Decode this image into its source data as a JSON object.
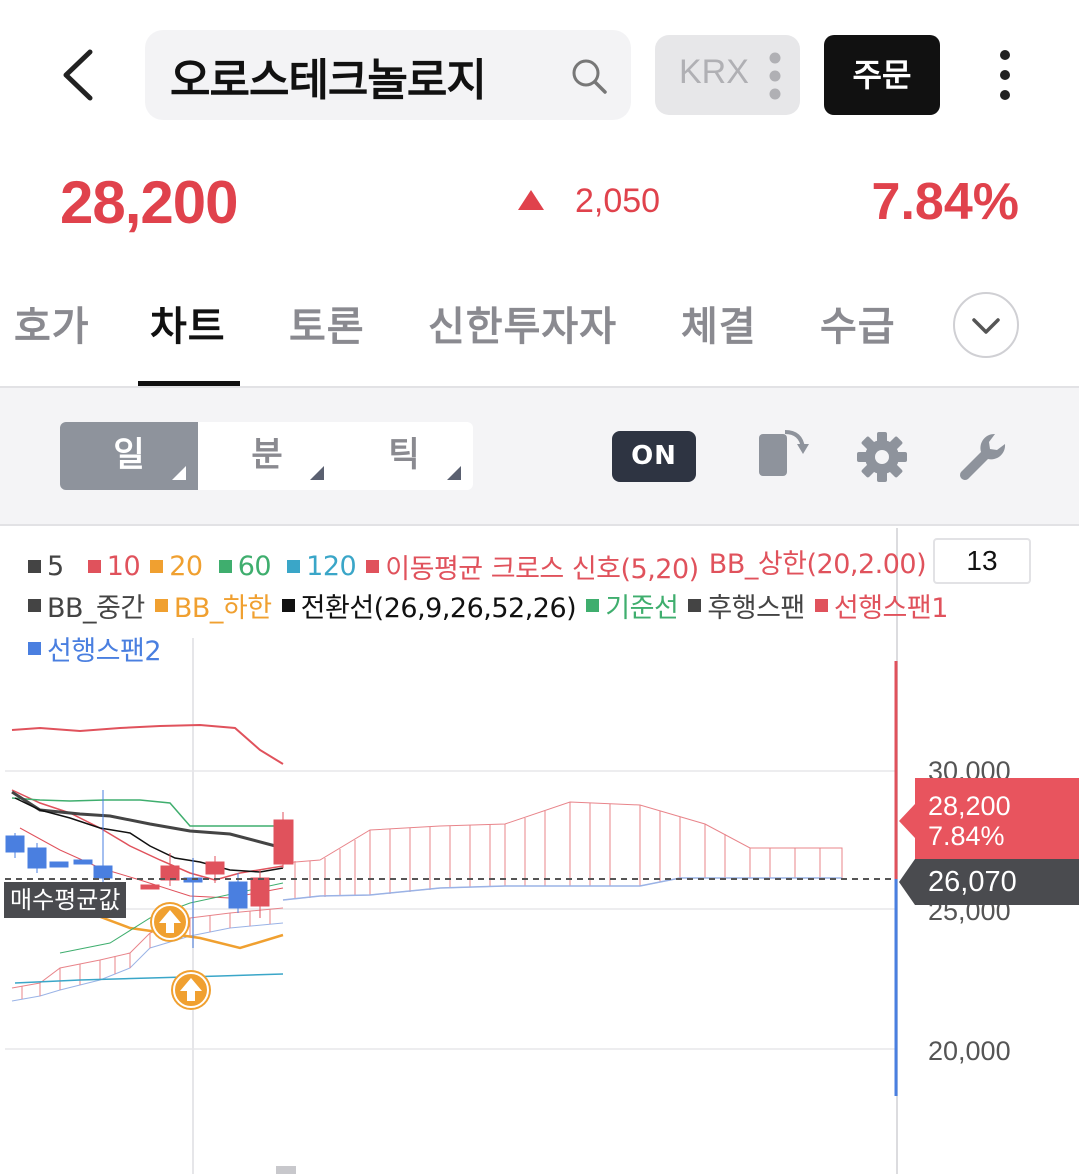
{
  "header": {
    "stock_name": "오로스테크놀로지",
    "exchange_label": "KRX",
    "order_label": "주문",
    "icons": [
      "back-arrow-icon",
      "search-icon",
      "more-vertical-icon"
    ]
  },
  "quote": {
    "price": "28,200",
    "change": "2,050",
    "change_pct": "7.84%",
    "direction": "up",
    "up_color": "#e0424c"
  },
  "tabs": [
    {
      "label": "호가",
      "active": false
    },
    {
      "label": "차트",
      "active": true
    },
    {
      "label": "토론",
      "active": false
    },
    {
      "label": "신한투자자",
      "active": false
    },
    {
      "label": "체결",
      "active": false
    },
    {
      "label": "수급",
      "active": false
    }
  ],
  "toolbar": {
    "periods": [
      {
        "label": "일",
        "active": true
      },
      {
        "label": "분",
        "active": false
      },
      {
        "label": "틱",
        "active": false
      }
    ],
    "toggle_label": "ON",
    "icons": [
      "rotate-screen-icon",
      "gear-icon",
      "wrench-icon"
    ]
  },
  "chart": {
    "count": "13",
    "legend": {
      "ma_5": "5",
      "ma_10": "10",
      "ma_20": "20",
      "ma_60": "60",
      "ma_120": "120",
      "cross": "이동평균 크로스 신호(5,20)",
      "bb_upper": "BB_상한(20,2.00)",
      "bb_mid": "BB_중간",
      "bb_lower": "BB_하한",
      "conversion": "전환선(26,9,26,52,26)",
      "base": "기준선",
      "lagging": "후행스팬",
      "lead1": "선행스팬1",
      "lead2": "선행스팬2"
    },
    "legend_colors": {
      "ma_5": "#444444",
      "ma_10": "#e0525c",
      "ma_20": "#f0a030",
      "ma_60": "#3fae6e",
      "ma_120": "#3aa6c8",
      "cross": "#e0525c",
      "bb_mid": "#444444",
      "bb_lower": "#f0a030",
      "conversion": "#111111",
      "base": "#3fae6e",
      "lagging": "#444444",
      "lead1": "#e0525c",
      "lead2": "#4a7fe0"
    },
    "avg_label": "매수평균값",
    "y_ticks": [
      "30,000",
      "25,000",
      "20,000"
    ],
    "current_price": "28,200",
    "current_pct": "7.84%",
    "avg_price": "26,070"
  }
}
